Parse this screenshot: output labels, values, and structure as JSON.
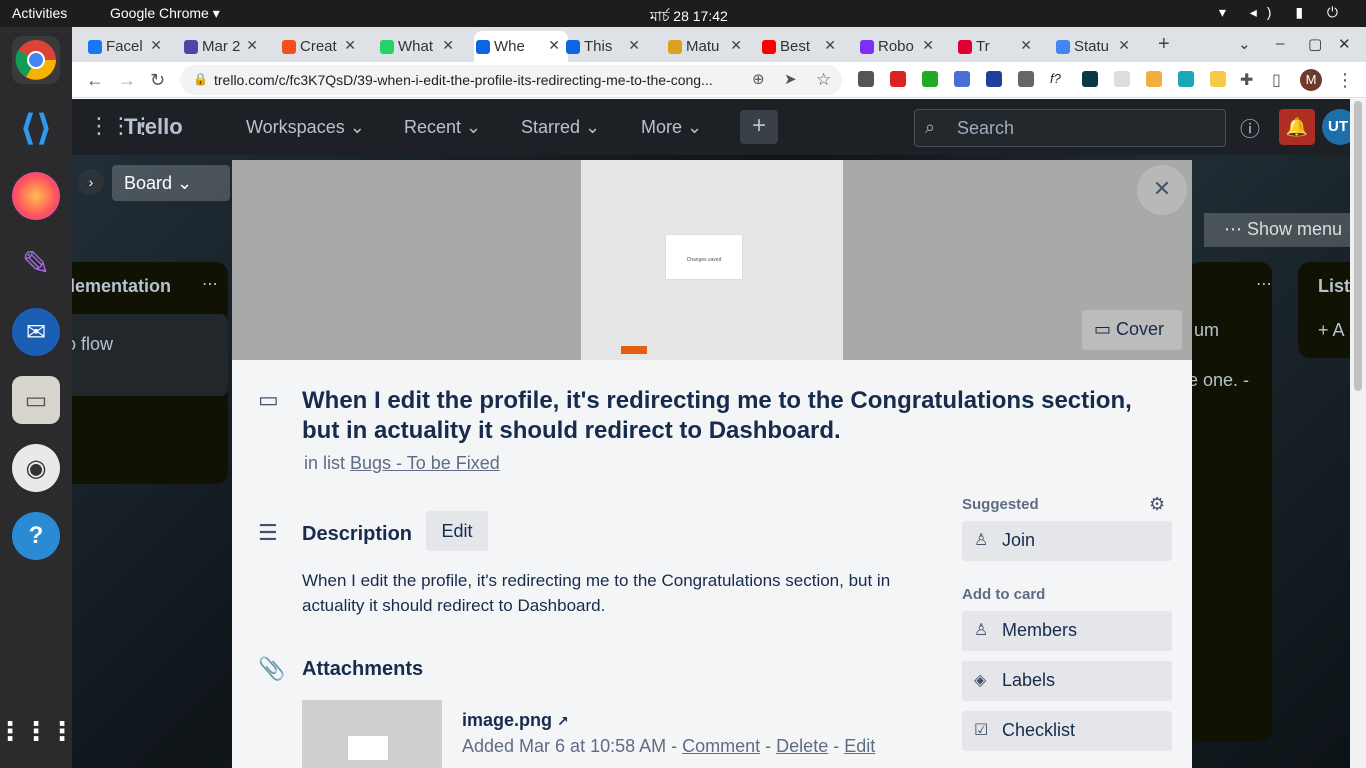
{
  "topbar": {
    "activities": "Activities",
    "app": "Google Chrome ▾",
    "clock": "মার্চ 28  17:42"
  },
  "tabs": [
    {
      "label": "Facel",
      "color": "#1877f2"
    },
    {
      "label": "Mar 2",
      "color": "#5243aa"
    },
    {
      "label": "Creat",
      "color": "#f24e1e"
    },
    {
      "label": "What",
      "color": "#25d366"
    },
    {
      "label": "Whe",
      "color": "#0c66e4",
      "active": true
    },
    {
      "label": "This",
      "color": "#0c66e4"
    },
    {
      "label": "Matu",
      "color": "#d9a320"
    },
    {
      "label": "Best",
      "color": "#ff0000"
    },
    {
      "label": "Robo",
      "color": "#7b2ff7"
    },
    {
      "label": "Tr",
      "color": "#dd0031"
    },
    {
      "label": "Statu",
      "color": "#4285f4"
    }
  ],
  "url": "trello.com/c/fc3K7QsD/39-when-i-edit-the-profile-its-redirecting-me-to-the-cong...",
  "trello": {
    "logo": "Trello",
    "nav": [
      "Workspaces ⌄",
      "Recent ⌄",
      "Starred ⌄",
      "More ⌄"
    ],
    "search_placeholder": "Search",
    "avatar": "UT",
    "board_view": "Board ⌄",
    "show_menu": "Show menu",
    "left_list_title": "lementation",
    "left_card": "o flow",
    "right_snippet1": "um",
    "right_snippet2": "e one. -",
    "right_list_title": "List",
    "right_add": "+ A"
  },
  "card": {
    "cover_label": "Cover",
    "title": "When I edit the profile, it's redirecting me to the Congratulations section, but in actuality it should redirect to Dashboard.",
    "in_list_prefix": "in list",
    "list_name": "Bugs - To be Fixed",
    "description_heading": "Description",
    "edit_label": "Edit",
    "description": "When I edit the profile, it's redirecting me to the Congratulations section, but in actuality it should redirect to Dashboard.",
    "attachments_heading": "Attachments",
    "attachment_name": "image.png",
    "attachment_added": "Added Mar 6 at 10:58 AM",
    "attachment_actions": [
      "Comment",
      "Delete",
      "Edit"
    ],
    "cover_image_text": "Changes saved"
  },
  "sidebar": {
    "suggested": "Suggested",
    "join": "Join",
    "add_to_card": "Add to card",
    "members": "Members",
    "labels": "Labels",
    "checklist": "Checklist"
  }
}
